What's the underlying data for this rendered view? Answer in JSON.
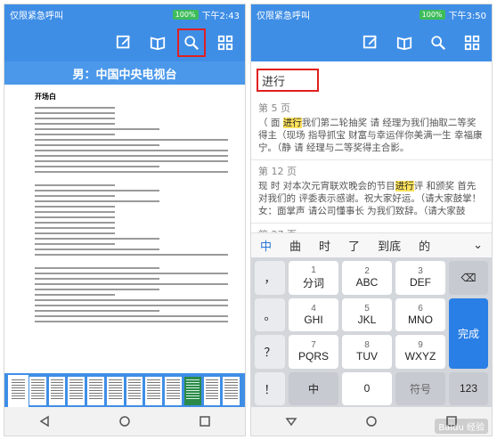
{
  "left": {
    "status": {
      "carrier": "仅限紧急呼叫",
      "battery": "100%",
      "time": "下午2:43"
    },
    "title": "男：中国中央电视台",
    "heading": "开场白",
    "thumbnail_count": 12,
    "active_thumbnail": 0,
    "green_thumbnail": 9
  },
  "right": {
    "status": {
      "carrier": "仅限紧急呼叫",
      "battery": "100%",
      "time": "下午3:50"
    },
    "search": {
      "query": "进行"
    },
    "results": [
      {
        "page": "第 5 页",
        "before": "（ 面 ",
        "hit": "进行",
        "after": "我们第二轮抽奖 请 经理为我们抽取二等奖得主（现场 指导抓宝 财富与幸运伴你美满一生 幸福康宁。（静 请 经理与二等奖得主合影。"
      },
      {
        "page": "第 12 页",
        "before": "现 时 对本次元宵联欢晚会的节目",
        "hit": "进行",
        "after": "评 和颁奖 首先对我们的 评委表示感谢。祝大家好运。（请大家鼓掌！女：面掌声 请公司懂事长 为我们致辞。（请大家鼓"
      },
      {
        "page": "第 27 页",
        "before": "",
        "hit": "",
        "after": ""
      }
    ],
    "candidates": [
      "中",
      "曲",
      "时",
      "了",
      "到底",
      "的"
    ],
    "keys": {
      "side": [
        "，",
        "。",
        "？",
        "！"
      ],
      "row1": [
        {
          "num": "1",
          "label": "分词"
        },
        {
          "num": "2",
          "label": "ABC"
        },
        {
          "num": "3",
          "label": "DEF"
        }
      ],
      "row2": [
        {
          "num": "4",
          "label": "GHI"
        },
        {
          "num": "5",
          "label": "JKL"
        },
        {
          "num": "6",
          "label": "MNO"
        }
      ],
      "row3": [
        {
          "num": "7",
          "label": "PQRS"
        },
        {
          "num": "8",
          "label": "TUV"
        },
        {
          "num": "9",
          "label": "WXYZ"
        }
      ],
      "bottom": {
        "symbol": "符",
        "lang": "中",
        "space": "0",
        "symbol2": "符号",
        "numbers": "123"
      },
      "done": "完成"
    }
  },
  "watermark": "Baidu 经验"
}
